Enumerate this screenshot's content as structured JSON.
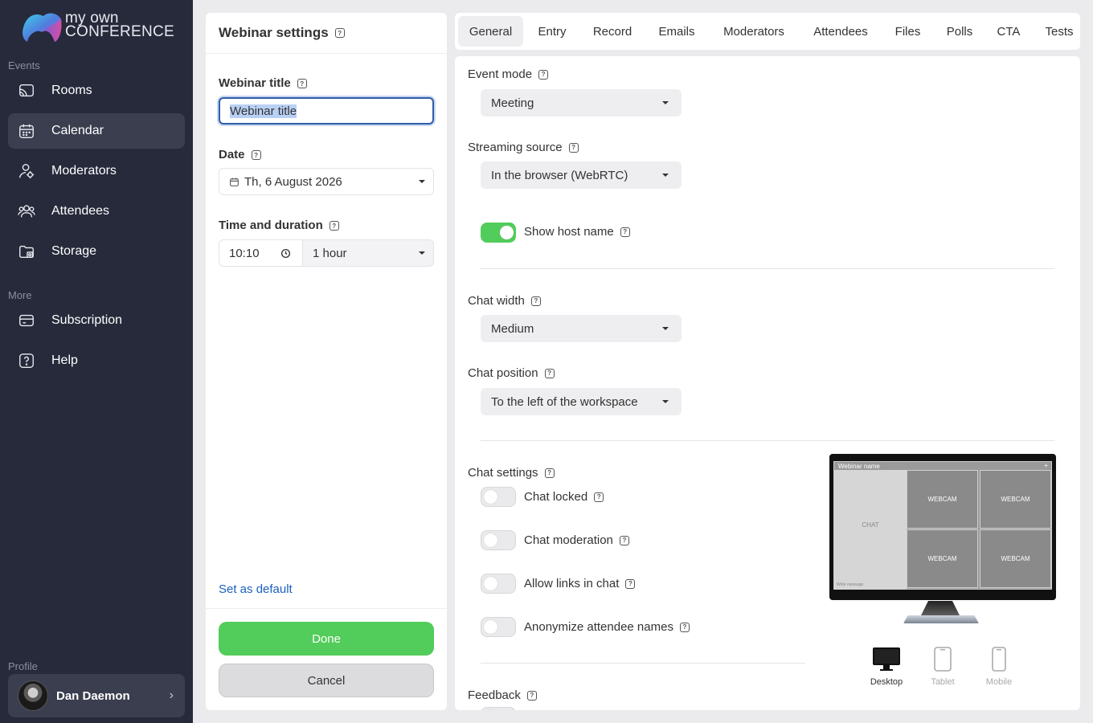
{
  "brand": {
    "line1": "my own",
    "line2": "CONFERENCE"
  },
  "sidebar": {
    "section_events": "Events",
    "items": [
      {
        "label": "Rooms",
        "icon": "cast-icon"
      },
      {
        "label": "Calendar",
        "icon": "calendar-icon",
        "active": true
      },
      {
        "label": "Moderators",
        "icon": "user-icon"
      },
      {
        "label": "Attendees",
        "icon": "users-icon"
      },
      {
        "label": "Storage",
        "icon": "folder-icon"
      }
    ],
    "section_more": "More",
    "more_items": [
      {
        "label": "Subscription",
        "icon": "card-icon"
      },
      {
        "label": "Help",
        "icon": "help-icon"
      }
    ],
    "section_profile": "Profile",
    "profile": {
      "name": "Dan Daemon"
    }
  },
  "panel": {
    "title": "Webinar settings",
    "webinar_title_label": "Webinar title",
    "webinar_title_value": "Webinar title",
    "date_label": "Date",
    "date_value": "Th, 6 August 2026",
    "time_label": "Time and duration",
    "time_value": "10:10",
    "duration_value": "1 hour",
    "set_default": "Set as default",
    "done": "Done",
    "cancel": "Cancel"
  },
  "tabs": [
    "General",
    "Entry",
    "Record",
    "Emails",
    "Moderators",
    "Attendees",
    "Files",
    "Polls",
    "CTA",
    "Tests"
  ],
  "active_tab": "General",
  "general": {
    "event_mode_label": "Event mode",
    "event_mode_value": "Meeting",
    "streaming_label": "Streaming source",
    "streaming_value": "In the browser (WebRTC)",
    "show_host_name": {
      "label": "Show host name",
      "on": true
    },
    "chat_width_label": "Chat width",
    "chat_width_value": "Medium",
    "chat_position_label": "Chat position",
    "chat_position_value": "To the left of the workspace",
    "chat_settings_label": "Chat settings",
    "chat_toggles": [
      {
        "label": "Chat locked",
        "on": false
      },
      {
        "label": "Chat moderation",
        "on": false
      },
      {
        "label": "Allow links in chat",
        "on": false
      },
      {
        "label": "Anonymize attendee names",
        "on": false
      }
    ],
    "feedback_label": "Feedback"
  },
  "preview": {
    "webinar_name": "Webinar name",
    "plus": "+",
    "chat": "CHAT",
    "write_message": "Write message",
    "webcam": "WEBCAM",
    "devices": [
      {
        "label": "Desktop",
        "active": true
      },
      {
        "label": "Tablet",
        "active": false
      },
      {
        "label": "Mobile",
        "active": false
      }
    ]
  },
  "colors": {
    "sidebar_bg": "#262a3b",
    "accent_green": "#52cc5a",
    "link_blue": "#1d5fbf"
  }
}
